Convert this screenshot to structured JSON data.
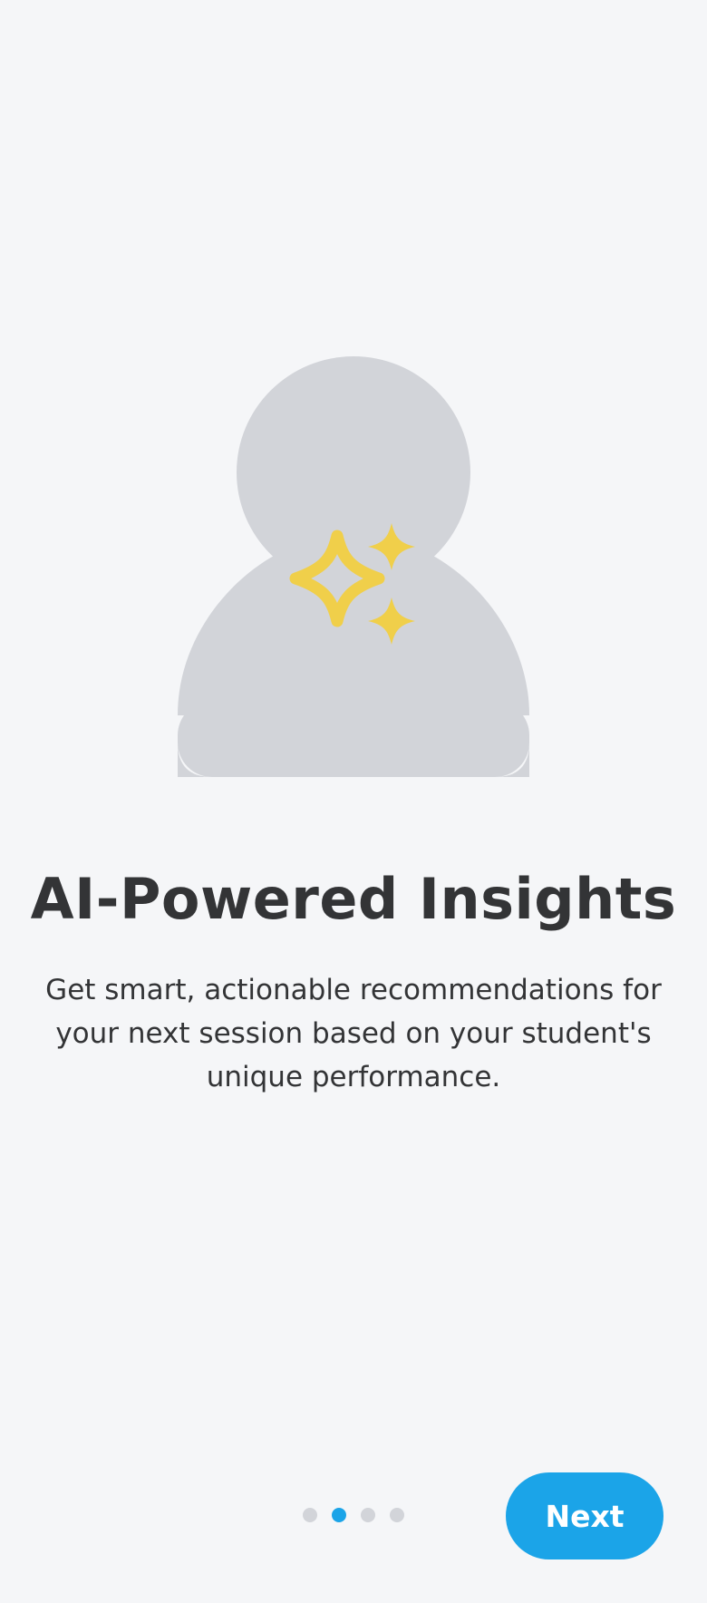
{
  "onboarding": {
    "title": "AI-Powered Insights",
    "description": "Get smart, actionable recommendations for your next session based on your student's unique performance.",
    "illustration_icon": "user-sparkles-icon",
    "pager": {
      "total_pages": 4,
      "current_page": 2
    },
    "next_label": "Next"
  },
  "colors": {
    "background": "#f5f6f8",
    "accent": "#1ba4e8",
    "silhouette": "#d2d4d9",
    "sparkle": "#f0cf4a",
    "text": "#333436",
    "inactive_dot": "#d2d4d9"
  }
}
